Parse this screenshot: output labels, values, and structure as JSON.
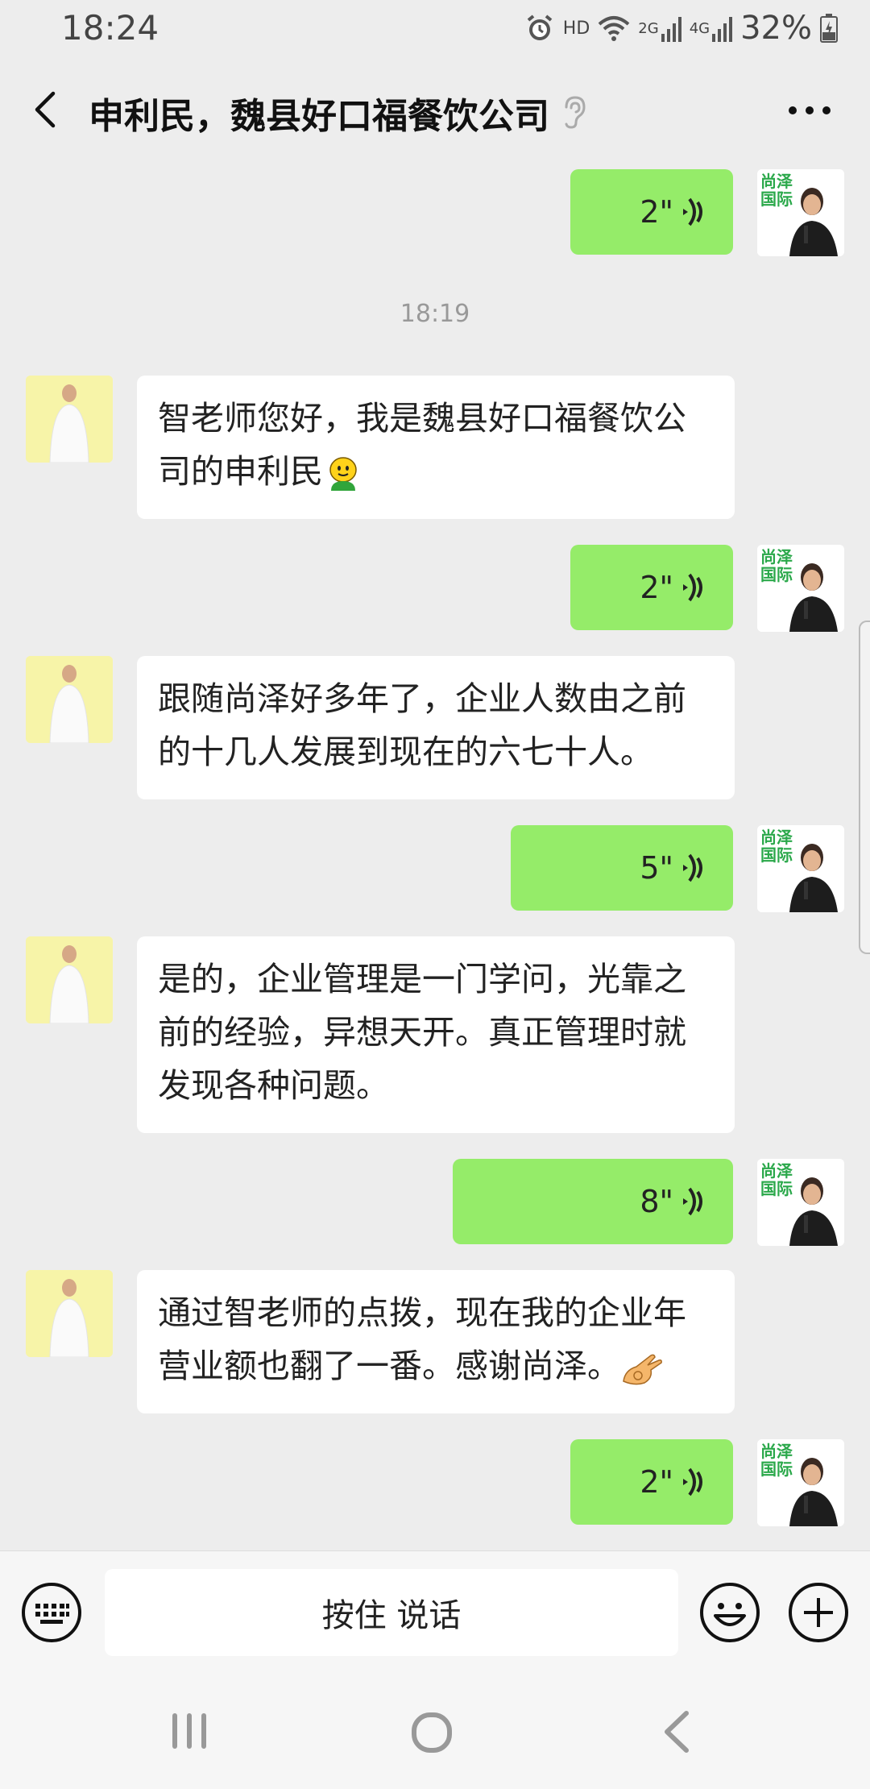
{
  "status_bar": {
    "time": "18:24",
    "network_label_hd": "HD",
    "network_label_2g": "2G",
    "network_label_4g": "4G",
    "battery": "32%",
    "icons": [
      "alarm-icon",
      "wifi-icon",
      "signal-2g-icon",
      "signal-4g-icon",
      "battery-icon"
    ]
  },
  "header": {
    "title": "申利民，魏县好口福餐饮公司",
    "icons": [
      "back-arrow-icon",
      "ear-icon",
      "more-icon"
    ]
  },
  "messages": [
    {
      "type": "voice",
      "side": "right",
      "duration": "2\""
    },
    {
      "type": "timestamp",
      "text": "18:19"
    },
    {
      "type": "text",
      "side": "left",
      "lines": [
        "智老师您好，我是魏县好口福餐饮公",
        "司的申利民"
      ],
      "emoji": "smile-emoji"
    },
    {
      "type": "voice",
      "side": "right",
      "duration": "2\""
    },
    {
      "type": "text",
      "side": "left",
      "lines": [
        "跟随尚泽好多年了，企业人数由之前",
        "的十几人发展到现在的六七十人。"
      ]
    },
    {
      "type": "voice",
      "side": "right",
      "duration": "5\""
    },
    {
      "type": "text",
      "side": "left",
      "lines": [
        "是的，企业管理是一门学问，光靠之",
        "前的经验，异想天开。真正管理时就",
        "发现各种问题。"
      ]
    },
    {
      "type": "voice",
      "side": "right",
      "duration": "8\""
    },
    {
      "type": "text",
      "side": "left",
      "lines": [
        "通过智老师的点拨，现在我的企业年",
        "营业额也翻了一番。感谢尚泽。"
      ],
      "emoji": "ok-hand-emoji"
    },
    {
      "type": "voice",
      "side": "right",
      "duration": "2\""
    }
  ],
  "avatar_right_text": "尚泽国际",
  "input_bar": {
    "hold_to_talk": "按住 说话",
    "icons": [
      "keyboard-icon",
      "emoji-icon",
      "plus-icon"
    ]
  },
  "system_nav": {
    "icons": [
      "recent-apps-icon",
      "home-icon",
      "back-icon"
    ]
  },
  "colors": {
    "background": "#ededed",
    "outgoing_bubble": "#95ec69",
    "incoming_bubble": "#ffffff",
    "brand_green": "#2aa84a"
  }
}
